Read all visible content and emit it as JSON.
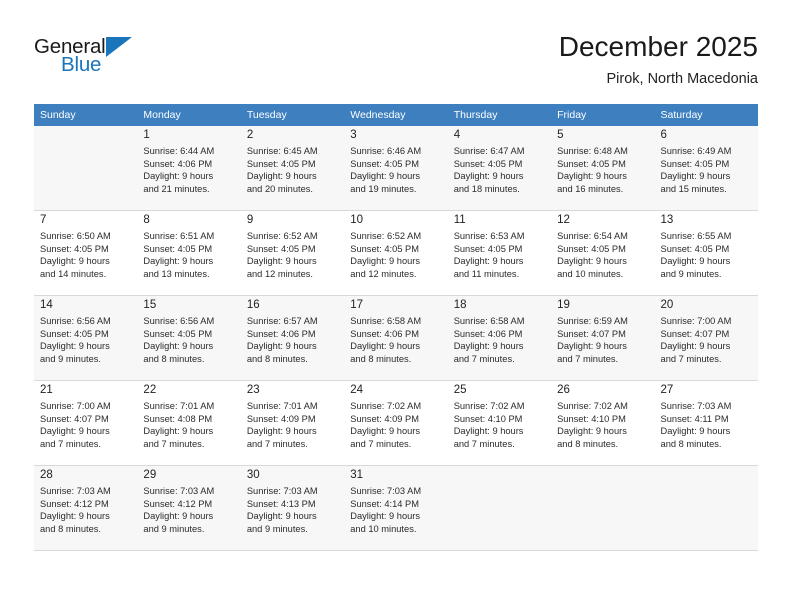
{
  "brand": {
    "name_top": "General",
    "name_bottom": "Blue",
    "accent_color": "#1b75bb",
    "triangle_icon": "triangle-icon"
  },
  "header": {
    "title": "December 2025",
    "subtitle": "Pirok, North Macedonia"
  },
  "theme": {
    "header_row_bg": "#3d7fbf",
    "alt_row_bg": "#f7f7f7",
    "grid_line": "#d8d8d8"
  },
  "weekday_headers": [
    "Sunday",
    "Monday",
    "Tuesday",
    "Wednesday",
    "Thursday",
    "Friday",
    "Saturday"
  ],
  "weeks": [
    {
      "shaded": true,
      "days": [
        {
          "num": "",
          "sunrise": "",
          "sunset": "",
          "daylight_1": "",
          "daylight_2": "",
          "empty": true
        },
        {
          "num": "1",
          "sunrise": "Sunrise: 6:44 AM",
          "sunset": "Sunset: 4:06 PM",
          "daylight_1": "Daylight: 9 hours",
          "daylight_2": "and 21 minutes.",
          "empty": false
        },
        {
          "num": "2",
          "sunrise": "Sunrise: 6:45 AM",
          "sunset": "Sunset: 4:05 PM",
          "daylight_1": "Daylight: 9 hours",
          "daylight_2": "and 20 minutes.",
          "empty": false
        },
        {
          "num": "3",
          "sunrise": "Sunrise: 6:46 AM",
          "sunset": "Sunset: 4:05 PM",
          "daylight_1": "Daylight: 9 hours",
          "daylight_2": "and 19 minutes.",
          "empty": false
        },
        {
          "num": "4",
          "sunrise": "Sunrise: 6:47 AM",
          "sunset": "Sunset: 4:05 PM",
          "daylight_1": "Daylight: 9 hours",
          "daylight_2": "and 18 minutes.",
          "empty": false
        },
        {
          "num": "5",
          "sunrise": "Sunrise: 6:48 AM",
          "sunset": "Sunset: 4:05 PM",
          "daylight_1": "Daylight: 9 hours",
          "daylight_2": "and 16 minutes.",
          "empty": false
        },
        {
          "num": "6",
          "sunrise": "Sunrise: 6:49 AM",
          "sunset": "Sunset: 4:05 PM",
          "daylight_1": "Daylight: 9 hours",
          "daylight_2": "and 15 minutes.",
          "empty": false
        }
      ]
    },
    {
      "shaded": false,
      "days": [
        {
          "num": "7",
          "sunrise": "Sunrise: 6:50 AM",
          "sunset": "Sunset: 4:05 PM",
          "daylight_1": "Daylight: 9 hours",
          "daylight_2": "and 14 minutes.",
          "empty": false
        },
        {
          "num": "8",
          "sunrise": "Sunrise: 6:51 AM",
          "sunset": "Sunset: 4:05 PM",
          "daylight_1": "Daylight: 9 hours",
          "daylight_2": "and 13 minutes.",
          "empty": false
        },
        {
          "num": "9",
          "sunrise": "Sunrise: 6:52 AM",
          "sunset": "Sunset: 4:05 PM",
          "daylight_1": "Daylight: 9 hours",
          "daylight_2": "and 12 minutes.",
          "empty": false
        },
        {
          "num": "10",
          "sunrise": "Sunrise: 6:52 AM",
          "sunset": "Sunset: 4:05 PM",
          "daylight_1": "Daylight: 9 hours",
          "daylight_2": "and 12 minutes.",
          "empty": false
        },
        {
          "num": "11",
          "sunrise": "Sunrise: 6:53 AM",
          "sunset": "Sunset: 4:05 PM",
          "daylight_1": "Daylight: 9 hours",
          "daylight_2": "and 11 minutes.",
          "empty": false
        },
        {
          "num": "12",
          "sunrise": "Sunrise: 6:54 AM",
          "sunset": "Sunset: 4:05 PM",
          "daylight_1": "Daylight: 9 hours",
          "daylight_2": "and 10 minutes.",
          "empty": false
        },
        {
          "num": "13",
          "sunrise": "Sunrise: 6:55 AM",
          "sunset": "Sunset: 4:05 PM",
          "daylight_1": "Daylight: 9 hours",
          "daylight_2": "and 9 minutes.",
          "empty": false
        }
      ]
    },
    {
      "shaded": true,
      "days": [
        {
          "num": "14",
          "sunrise": "Sunrise: 6:56 AM",
          "sunset": "Sunset: 4:05 PM",
          "daylight_1": "Daylight: 9 hours",
          "daylight_2": "and 9 minutes.",
          "empty": false
        },
        {
          "num": "15",
          "sunrise": "Sunrise: 6:56 AM",
          "sunset": "Sunset: 4:05 PM",
          "daylight_1": "Daylight: 9 hours",
          "daylight_2": "and 8 minutes.",
          "empty": false
        },
        {
          "num": "16",
          "sunrise": "Sunrise: 6:57 AM",
          "sunset": "Sunset: 4:06 PM",
          "daylight_1": "Daylight: 9 hours",
          "daylight_2": "and 8 minutes.",
          "empty": false
        },
        {
          "num": "17",
          "sunrise": "Sunrise: 6:58 AM",
          "sunset": "Sunset: 4:06 PM",
          "daylight_1": "Daylight: 9 hours",
          "daylight_2": "and 8 minutes.",
          "empty": false
        },
        {
          "num": "18",
          "sunrise": "Sunrise: 6:58 AM",
          "sunset": "Sunset: 4:06 PM",
          "daylight_1": "Daylight: 9 hours",
          "daylight_2": "and 7 minutes.",
          "empty": false
        },
        {
          "num": "19",
          "sunrise": "Sunrise: 6:59 AM",
          "sunset": "Sunset: 4:07 PM",
          "daylight_1": "Daylight: 9 hours",
          "daylight_2": "and 7 minutes.",
          "empty": false
        },
        {
          "num": "20",
          "sunrise": "Sunrise: 7:00 AM",
          "sunset": "Sunset: 4:07 PM",
          "daylight_1": "Daylight: 9 hours",
          "daylight_2": "and 7 minutes.",
          "empty": false
        }
      ]
    },
    {
      "shaded": false,
      "days": [
        {
          "num": "21",
          "sunrise": "Sunrise: 7:00 AM",
          "sunset": "Sunset: 4:07 PM",
          "daylight_1": "Daylight: 9 hours",
          "daylight_2": "and 7 minutes.",
          "empty": false
        },
        {
          "num": "22",
          "sunrise": "Sunrise: 7:01 AM",
          "sunset": "Sunset: 4:08 PM",
          "daylight_1": "Daylight: 9 hours",
          "daylight_2": "and 7 minutes.",
          "empty": false
        },
        {
          "num": "23",
          "sunrise": "Sunrise: 7:01 AM",
          "sunset": "Sunset: 4:09 PM",
          "daylight_1": "Daylight: 9 hours",
          "daylight_2": "and 7 minutes.",
          "empty": false
        },
        {
          "num": "24",
          "sunrise": "Sunrise: 7:02 AM",
          "sunset": "Sunset: 4:09 PM",
          "daylight_1": "Daylight: 9 hours",
          "daylight_2": "and 7 minutes.",
          "empty": false
        },
        {
          "num": "25",
          "sunrise": "Sunrise: 7:02 AM",
          "sunset": "Sunset: 4:10 PM",
          "daylight_1": "Daylight: 9 hours",
          "daylight_2": "and 7 minutes.",
          "empty": false
        },
        {
          "num": "26",
          "sunrise": "Sunrise: 7:02 AM",
          "sunset": "Sunset: 4:10 PM",
          "daylight_1": "Daylight: 9 hours",
          "daylight_2": "and 8 minutes.",
          "empty": false
        },
        {
          "num": "27",
          "sunrise": "Sunrise: 7:03 AM",
          "sunset": "Sunset: 4:11 PM",
          "daylight_1": "Daylight: 9 hours",
          "daylight_2": "and 8 minutes.",
          "empty": false
        }
      ]
    },
    {
      "shaded": true,
      "days": [
        {
          "num": "28",
          "sunrise": "Sunrise: 7:03 AM",
          "sunset": "Sunset: 4:12 PM",
          "daylight_1": "Daylight: 9 hours",
          "daylight_2": "and 8 minutes.",
          "empty": false
        },
        {
          "num": "29",
          "sunrise": "Sunrise: 7:03 AM",
          "sunset": "Sunset: 4:12 PM",
          "daylight_1": "Daylight: 9 hours",
          "daylight_2": "and 9 minutes.",
          "empty": false
        },
        {
          "num": "30",
          "sunrise": "Sunrise: 7:03 AM",
          "sunset": "Sunset: 4:13 PM",
          "daylight_1": "Daylight: 9 hours",
          "daylight_2": "and 9 minutes.",
          "empty": false
        },
        {
          "num": "31",
          "sunrise": "Sunrise: 7:03 AM",
          "sunset": "Sunset: 4:14 PM",
          "daylight_1": "Daylight: 9 hours",
          "daylight_2": "and 10 minutes.",
          "empty": false
        },
        {
          "num": "",
          "sunrise": "",
          "sunset": "",
          "daylight_1": "",
          "daylight_2": "",
          "empty": true
        },
        {
          "num": "",
          "sunrise": "",
          "sunset": "",
          "daylight_1": "",
          "daylight_2": "",
          "empty": true
        },
        {
          "num": "",
          "sunrise": "",
          "sunset": "",
          "daylight_1": "",
          "daylight_2": "",
          "empty": true
        }
      ]
    }
  ]
}
